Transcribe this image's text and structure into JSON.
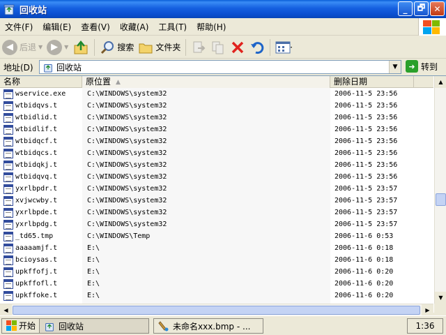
{
  "window": {
    "title": "回收站",
    "minimize_glyph": "_",
    "restore_glyph": "🗗",
    "close_glyph": "✕"
  },
  "menu": [
    "文件(F)",
    "编辑(E)",
    "查看(V)",
    "收藏(A)",
    "工具(T)",
    "帮助(H)"
  ],
  "toolbar": {
    "back_label": "后退",
    "search_label": "搜索",
    "folders_label": "文件夹"
  },
  "address": {
    "label": "地址(D)",
    "value": "回收站",
    "go_label": "转到"
  },
  "columns": [
    "名称",
    "原位置",
    "删除日期"
  ],
  "files": [
    {
      "name": "wservice.exe",
      "location": "C:\\WINDOWS\\system32",
      "deleted": "2006-11-5 23:56",
      "icon": "executable-icon"
    },
    {
      "name": "wtbidqvs.t",
      "location": "C:\\WINDOWS\\system32",
      "deleted": "2006-11-5 23:56",
      "icon": "file-icon"
    },
    {
      "name": "wtbidlid.t",
      "location": "C:\\WINDOWS\\system32",
      "deleted": "2006-11-5 23:56",
      "icon": "file-icon"
    },
    {
      "name": "wtbidlif.t",
      "location": "C:\\WINDOWS\\system32",
      "deleted": "2006-11-5 23:56",
      "icon": "file-icon"
    },
    {
      "name": "wtbidqcf.t",
      "location": "C:\\WINDOWS\\system32",
      "deleted": "2006-11-5 23:56",
      "icon": "file-icon"
    },
    {
      "name": "wtbidqcs.t",
      "location": "C:\\WINDOWS\\system32",
      "deleted": "2006-11-5 23:56",
      "icon": "file-icon"
    },
    {
      "name": "wtbidqkj.t",
      "location": "C:\\WINDOWS\\system32",
      "deleted": "2006-11-5 23:56",
      "icon": "file-icon"
    },
    {
      "name": "wtbidqvq.t",
      "location": "C:\\WINDOWS\\system32",
      "deleted": "2006-11-5 23:56",
      "icon": "file-icon"
    },
    {
      "name": "yxrlbpdr.t",
      "location": "C:\\WINDOWS\\system32",
      "deleted": "2006-11-5 23:57",
      "icon": "file-icon"
    },
    {
      "name": "xvjwcwby.t",
      "location": "C:\\WINDOWS\\system32",
      "deleted": "2006-11-5 23:57",
      "icon": "file-icon"
    },
    {
      "name": "yxrlbpde.t",
      "location": "C:\\WINDOWS\\system32",
      "deleted": "2006-11-5 23:57",
      "icon": "file-icon"
    },
    {
      "name": "yxrlbpdg.t",
      "location": "C:\\WINDOWS\\system32",
      "deleted": "2006-11-5 23:57",
      "icon": "file-icon"
    },
    {
      "name": "_td65.tmp",
      "location": "C:\\WINDOWS\\Temp",
      "deleted": "2006-11-6 0:53",
      "icon": "file-icon"
    },
    {
      "name": "aaaaamjf.t",
      "location": "E:\\",
      "deleted": "2006-11-6 0:18",
      "icon": "file-icon"
    },
    {
      "name": "bcioysas.t",
      "location": "E:\\",
      "deleted": "2006-11-6 0:18",
      "icon": "file-icon"
    },
    {
      "name": "upkffofj.t",
      "location": "E:\\",
      "deleted": "2006-11-6 0:20",
      "icon": "file-icon"
    },
    {
      "name": "upkffofl.t",
      "location": "E:\\",
      "deleted": "2006-11-6 0:20",
      "icon": "file-icon"
    },
    {
      "name": "upkffoke.t",
      "location": "E:\\",
      "deleted": "2006-11-6 0:20",
      "icon": "file-icon"
    }
  ],
  "taskbar": {
    "start_label": "开始",
    "tasks": [
      "回收站",
      "未命名xxx.bmp - ..."
    ],
    "clock": "1:36"
  },
  "colors": {
    "title_blue": "#0a4fd0",
    "sort_column_bg": "#f7f7f7",
    "go_green": "#2aa02a"
  }
}
